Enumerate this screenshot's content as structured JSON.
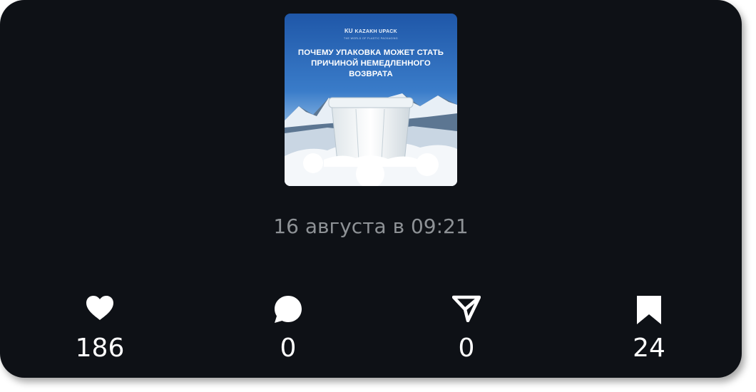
{
  "post": {
    "image": {
      "brand_name": "KAZAKH UPACK",
      "brand_logo": "KU",
      "brand_tagline": "THE WORLD OF PLASTIC PACKAGING",
      "headline": "ПОЧЕМУ УПАКОВКА МОЖЕТ СТАТЬ ПРИЧИНОЙ НЕМЕДЛЕННОГО ВОЗВРАТА"
    },
    "timestamp": "16 августа в 09:21"
  },
  "stats": {
    "likes": {
      "icon": "heart-icon",
      "count": "186"
    },
    "comments": {
      "icon": "comment-icon",
      "count": "0"
    },
    "shares": {
      "icon": "send-icon",
      "count": "0"
    },
    "saves": {
      "icon": "bookmark-icon",
      "count": "24"
    }
  },
  "colors": {
    "background": "#0e1116",
    "text": "#ffffff",
    "muted_text": "#8e9296"
  }
}
